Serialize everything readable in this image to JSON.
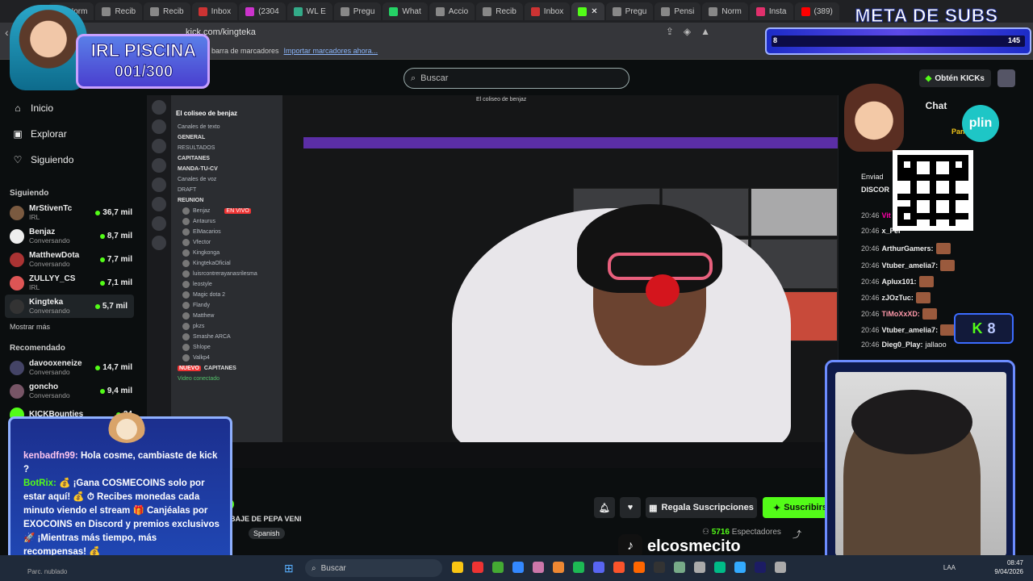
{
  "browser": {
    "tabs": [
      {
        "label": "Norm",
        "color": "#888"
      },
      {
        "label": "Recib",
        "color": "#888"
      },
      {
        "label": "Recib",
        "color": "#888"
      },
      {
        "label": "Inbox",
        "color": "#c33"
      },
      {
        "label": "(2304",
        "color": "#c3c"
      },
      {
        "label": "WL E",
        "color": "#3a8"
      },
      {
        "label": "Pregu",
        "color": "#888"
      },
      {
        "label": "What",
        "color": "#25d366"
      },
      {
        "label": "Accio",
        "color": "#888"
      },
      {
        "label": "Recib",
        "color": "#888"
      },
      {
        "label": "Inbox",
        "color": "#c33"
      },
      {
        "label": "",
        "color": "#53fc18"
      },
      {
        "label": "Pregu",
        "color": "#888"
      },
      {
        "label": "Pensi",
        "color": "#888"
      },
      {
        "label": "Norm",
        "color": "#888"
      },
      {
        "label": "Insta",
        "color": "#e1306c"
      },
      {
        "label": "(389)",
        "color": "#f00"
      },
      {
        "label": "(389)",
        "color": "#f00"
      }
    ],
    "url": "kick.com/kingteka",
    "bookmarks_text": "barra de marcadores",
    "bookmarks_link": "Importar marcadores ahora..."
  },
  "header": {
    "search_placeholder": "Buscar",
    "kicks_label": "Obtén KICKs"
  },
  "sidebar": {
    "nav": [
      {
        "label": "Inicio",
        "icon": "⌂"
      },
      {
        "label": "Explorar",
        "icon": "▣"
      },
      {
        "label": "Siguiendo",
        "icon": "♡"
      }
    ],
    "following_title": "Siguiendo",
    "following": [
      {
        "name": "MrStivenTc",
        "sub": "IRL",
        "viewers": "36,7 mil",
        "color": "#7a5a40"
      },
      {
        "name": "Benjaz",
        "sub": "Conversando",
        "viewers": "8,7 mil",
        "color": "#eee"
      },
      {
        "name": "MatthewDota",
        "sub": "Conversando",
        "viewers": "7,7 mil",
        "color": "#a33"
      },
      {
        "name": "ZULLYY_CS",
        "sub": "IRL",
        "viewers": "7,1 mil",
        "color": "#d55"
      },
      {
        "name": "Kingteka",
        "sub": "Conversando",
        "viewers": "5,7 mil",
        "color": "#333"
      }
    ],
    "show_more": "Mostrar más",
    "recommended_title": "Recomendado",
    "recommended": [
      {
        "name": "davooxeneize",
        "sub": "Conversando",
        "viewers": "14,7 mil",
        "color": "#446"
      },
      {
        "name": "goncho",
        "sub": "Conversando",
        "viewers": "9,4 mil",
        "color": "#756"
      },
      {
        "name": "KICKBounties",
        "sub": "",
        "viewers": "24",
        "color": "#53fc18"
      }
    ]
  },
  "discord": {
    "server_name": "El coliseo de benjaz",
    "channels": [
      "Canales de texto",
      "GENERAL",
      "RESULTADOS",
      "CAPITANES",
      "MANDA-TU-CV",
      "Canales de voz",
      "DRAFT",
      "REUNION"
    ],
    "users": [
      "Benjaz",
      "Antaurus",
      "ElMacarios",
      "Vfector",
      "Kingkonga",
      "KingtekaOficial",
      "luisrcontrerayanasrilesma",
      "leostyle",
      "Magic dota 2",
      "Flandy",
      "Matthew",
      "pkzs",
      "Smashe ARCA",
      "Shlope",
      "Valkp4"
    ],
    "video_status": "Video conectado",
    "live_badge": "EN VIVO",
    "new_badge": "NUEVO",
    "capitanes": "CAPITANES"
  },
  "stream": {
    "window_title": "El coliseo de benjaz",
    "channel_name": "Kingteka",
    "channel_name_visible": "ka",
    "stream_title": "DIO TU BAJE DE PEPA VENI",
    "category": "ndo",
    "language": "Spanish",
    "viewers_count": "5716",
    "viewers_label": "Espectadores",
    "gift_label": "Regala Suscripciones",
    "subscribe_label": "Suscribirs"
  },
  "chat": {
    "title": "Chat",
    "messages": [
      {
        "time": "20:46",
        "user": "Vit",
        "user_color": "#f0a",
        "text": ""
      },
      {
        "time": "20:46",
        "user": "x_Fer",
        "user_color": "#ccc",
        "text": ""
      },
      {
        "time": "20:46",
        "user": "ArthurGamers:",
        "user_color": "#eee",
        "text": ""
      },
      {
        "time": "20:46",
        "user": "Vtuber_amelia7:",
        "user_color": "#eee",
        "text": ""
      },
      {
        "time": "20:46",
        "user": "Aplux101:",
        "user_color": "#eee",
        "text": ""
      },
      {
        "time": "20:46",
        "user": "zJOzTuc:",
        "user_color": "#eee",
        "text": ""
      },
      {
        "time": "20:46",
        "user": "TiMoXxXD:",
        "user_color": "#f9a",
        "text": ""
      },
      {
        "time": "20:46",
        "user": "Vtuber_amelia7:",
        "user_color": "#eee",
        "text": ""
      },
      {
        "time": "20:46",
        "user": "Dieg0_Play:",
        "user_color": "#eee",
        "text": "jallaoo"
      }
    ],
    "pinned_user": "Pandita_S",
    "pinned_label": "Enviad",
    "discord_label": "DISCOR"
  },
  "overlays": {
    "piscina_line1": "IRL PISCINA",
    "piscina_line2": "001/300",
    "meta_title": "META DE SUBS",
    "meta_current": "8",
    "meta_goal": "145",
    "plin_label": "plin",
    "kick_badge": "8",
    "tiktok_handle": "elcosmecito"
  },
  "overlay_chat": {
    "m1_user": "kenbadfn99:",
    "m1_text": "Hola cosme, cambiaste de kick ?",
    "m2_user": "BotRix:",
    "m2_text": "💰 ¡Gana COSMECOINS solo por estar aquí! 💰 ⏱ Recibes monedas cada minuto viendo el stream 🎁 Canjéalas por EXOCOINS en Discord y premios exclusivos 🚀 ¡Mientras más tiempo, más recompensas! 💰"
  },
  "taskbar": {
    "search_placeholder": "Buscar",
    "lang": "LAA",
    "time": "08:47",
    "date": "9/04/2026",
    "left_status": "Parc. nublado",
    "icon_colors": [
      "#f9c513",
      "#e33",
      "#4a3",
      "#38f",
      "#c7a",
      "#e83",
      "#1db954",
      "#5865f2",
      "#fb542b",
      "#f60",
      "#333",
      "#7a8",
      "#aaa",
      "#0b8",
      "#3af",
      "#1c1c64",
      "#aaa"
    ]
  }
}
